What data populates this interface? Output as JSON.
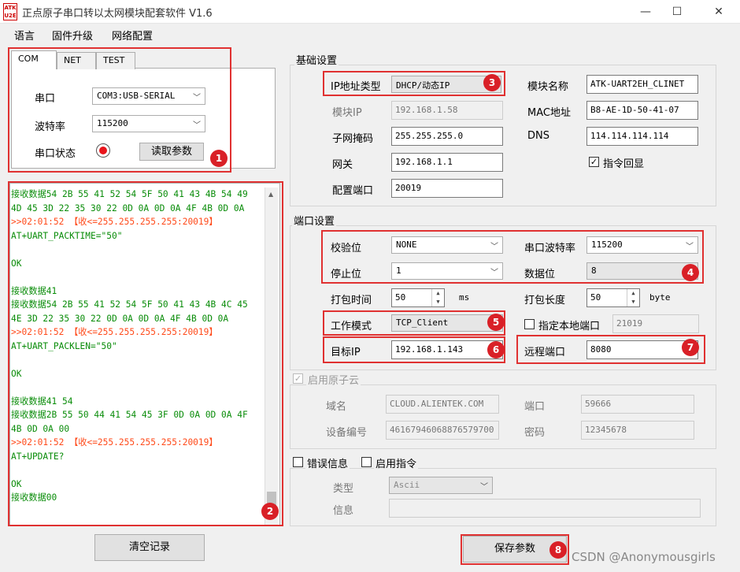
{
  "window": {
    "logo": "ATK U2E",
    "title": "正点原子串口转以太网模块配套软件 V1.6",
    "min": "—",
    "max": "☐",
    "close": "✕"
  },
  "menu": {
    "language": "语言",
    "firmware": "固件升级",
    "network": "网络配置"
  },
  "tabs": {
    "com": "COM",
    "net": "NET",
    "test": "TEST"
  },
  "serial": {
    "port_label": "串口",
    "port_value": "COM3:USB-SERIAL",
    "baud_label": "波特率",
    "baud_value": "115200",
    "status_label": "串口状态",
    "read_button": "读取参数"
  },
  "log_lines": [
    {
      "t": "接收数据54 2B 55 41 52 54 5F 50 41 43 4B 54 49",
      "c": "g"
    },
    {
      "t": "4D 45 3D 22 35 30 22 0D 0A 0D 0A 4F 4B 0D 0A",
      "c": "g"
    },
    {
      "t": ">>02:01:52 【收<=255.255.255.255:20019】",
      "c": "r"
    },
    {
      "t": "AT+UART_PACKTIME=\"50\"",
      "c": "g"
    },
    {
      "t": "",
      "c": "g"
    },
    {
      "t": "OK",
      "c": "g"
    },
    {
      "t": "",
      "c": "g"
    },
    {
      "t": "接收数据41",
      "c": "g"
    },
    {
      "t": "接收数据54 2B 55 41 52 54 5F 50 41 43 4B 4C 45",
      "c": "g"
    },
    {
      "t": "4E 3D 22 35 30 22 0D 0A 0D 0A 4F 4B 0D 0A",
      "c": "g"
    },
    {
      "t": ">>02:01:52 【收<=255.255.255.255:20019】",
      "c": "r"
    },
    {
      "t": "AT+UART_PACKLEN=\"50\"",
      "c": "g"
    },
    {
      "t": "",
      "c": "g"
    },
    {
      "t": "OK",
      "c": "g"
    },
    {
      "t": "",
      "c": "g"
    },
    {
      "t": "接收数据41 54",
      "c": "g"
    },
    {
      "t": "接收数据2B 55 50 44 41 54 45 3F 0D 0A 0D 0A 4F",
      "c": "g"
    },
    {
      "t": "4B 0D 0A 00",
      "c": "g"
    },
    {
      "t": ">>02:01:52 【收<=255.255.255.255:20019】",
      "c": "r"
    },
    {
      "t": "AT+UPDATE?",
      "c": "g"
    },
    {
      "t": "",
      "c": "g"
    },
    {
      "t": "OK",
      "c": "g"
    },
    {
      "t": "接收数据00",
      "c": "g"
    }
  ],
  "clear_button": "清空记录",
  "basic": {
    "group": "基础设置",
    "ip_type_label": "IP地址类型",
    "ip_type_value": "DHCP/动态IP",
    "module_ip_label": "模块IP",
    "module_ip_value": "192.168.1.58",
    "subnet_label": "子网掩码",
    "subnet_value": "255.255.255.0",
    "gateway_label": "网关",
    "gateway_value": "192.168.1.1",
    "config_port_label": "配置端口",
    "config_port_value": "20019",
    "module_name_label": "模块名称",
    "module_name_value": "ATK-UART2EH_CLINET",
    "mac_label": "MAC地址",
    "mac_value": "B8-AE-1D-50-41-07",
    "dns_label": "DNS",
    "dns_value": "114.114.114.114",
    "echo_label": "指令回显",
    "echo_checked": "✓"
  },
  "port": {
    "group": "端口设置",
    "parity_label": "校验位",
    "parity_value": "NONE",
    "serial_baud_label": "串口波特率",
    "serial_baud_value": "115200",
    "stop_label": "停止位",
    "stop_value": "1",
    "data_bits_label": "数据位",
    "data_bits_value": "8",
    "pack_time_label": "打包时间",
    "pack_time_value": "50",
    "pack_time_unit": "ms",
    "pack_len_label": "打包长度",
    "pack_len_value": "50",
    "pack_len_unit": "byte",
    "mode_label": "工作模式",
    "mode_value": "TCP_Client",
    "local_port_label": "指定本地端口",
    "local_port_value": "21019",
    "target_ip_label": "目标IP",
    "target_ip_value": "192.168.1.143",
    "remote_port_label": "远程端口",
    "remote_port_value": "8080"
  },
  "cloud": {
    "enable_label": "启用原子云",
    "domain_label": "域名",
    "domain_value": "CLOUD.ALIENTEK.COM",
    "cport_label": "端口",
    "cport_value": "59666",
    "device_label": "设备编号",
    "device_value": "46167946068876579700",
    "pwd_label": "密码",
    "pwd_value": "12345678"
  },
  "error": {
    "error_label": "错误信息",
    "cmd_label": "启用指令",
    "type_label": "类型",
    "type_value": "Ascii",
    "info_label": "信息"
  },
  "save_button": "保存参数",
  "badges": [
    "1",
    "2",
    "3",
    "4",
    "5",
    "6",
    "7",
    "8"
  ],
  "watermark": "CSDN @Anonymousgirls",
  "colors": {
    "highlight": "#e03131",
    "badge": "#d92027",
    "log_text": "#098c09",
    "log_rx": "#ff4a1a"
  }
}
